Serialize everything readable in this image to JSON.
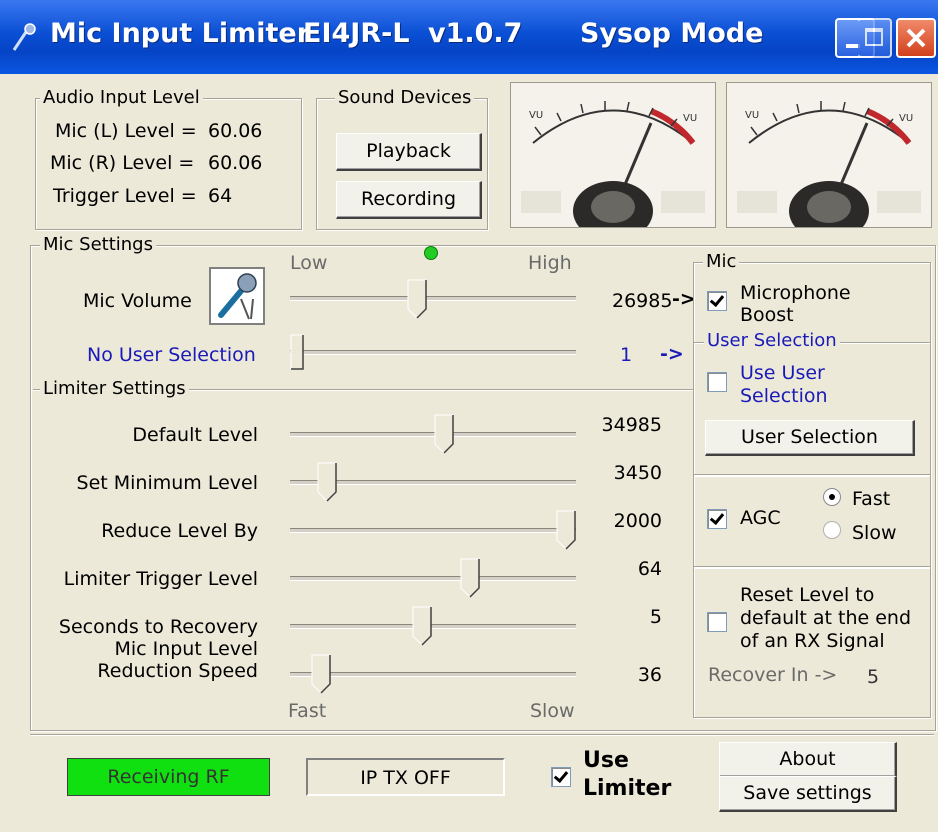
{
  "window": {
    "app_name": "Mic Input Limiter",
    "callsign": "EI4JR-L",
    "version": "v1.0.7",
    "mode": "Sysop Mode"
  },
  "audio_input": {
    "title": "Audio Input Level",
    "mic_l": "Mic (L) Level =",
    "mic_l_value": "60.06",
    "mic_r": "Mic (R) Level =",
    "mic_r_value": "60.06",
    "trigger": "Trigger Level =",
    "trigger_value": "64"
  },
  "sound_devices": {
    "title": "Sound Devices",
    "playback": "Playback",
    "recording": "Recording"
  },
  "mic_settings": {
    "title": "Mic Settings",
    "low": "Low",
    "high": "High",
    "mic_volume_label": "Mic Volume",
    "mic_volume_value": "26985",
    "mic_volume_arrow": "->",
    "mic_volume_fraction": 0.44,
    "user_selection_label": "No User Selection",
    "user_selection_value": "1",
    "user_selection_arrow": "->",
    "user_selection_fraction": 0.0
  },
  "limiter_settings": {
    "title": "Limiter Settings",
    "rows": [
      {
        "label": "Default Level",
        "value": "34985",
        "fraction": 0.54
      },
      {
        "label": "Set Minimum Level",
        "value": "3450",
        "fraction": 0.1
      },
      {
        "label": "Reduce Level By",
        "value": "2000",
        "fraction": 1.0
      },
      {
        "label": "Limiter Trigger Level",
        "value": "64",
        "fraction": 0.64
      },
      {
        "label": "Seconds to Recovery",
        "value": "5",
        "fraction": 0.46
      },
      {
        "label": "Mic Input Level Reduction Speed",
        "label_line1": "Mic Input Level",
        "label_line2": "Reduction Speed",
        "value": "36",
        "fraction": 0.08
      }
    ],
    "fast": "Fast",
    "slow": "Slow"
  },
  "mic_panel": {
    "title": "Mic",
    "boost_line1": "Microphone",
    "boost_line2": "Boost",
    "boost_checked": true
  },
  "user_panel": {
    "title": "User Selection",
    "use_line1": "Use User",
    "use_line2": "Selection",
    "use_checked": false,
    "button": "User Selection"
  },
  "agc": {
    "label": "AGC",
    "checked": true,
    "fast": "Fast",
    "slow": "Slow",
    "selected": "Fast"
  },
  "reset": {
    "line1": "Reset Level to",
    "line2": "default at the end",
    "line3": "of an RX Signal",
    "checked": false,
    "recover_label": "Recover In ->",
    "recover_value": "5"
  },
  "bottom": {
    "receiving": "Receiving  RF",
    "receiving_color": "#10e010",
    "iptx": "IP  TX  OFF",
    "use_limiter_line1": "Use",
    "use_limiter_line2": "Limiter",
    "use_limiter_checked": true,
    "about": "About",
    "save": "Save settings"
  },
  "colors": {
    "title_bar": "#0a4fd4",
    "indicator_led": "#22cc22",
    "link_blue": "#1a1ab8",
    "needle_red": "#c0282e"
  },
  "icons": [
    "microphone-icon",
    "app-icon",
    "minimize-icon",
    "maximize-icon",
    "close-icon"
  ]
}
